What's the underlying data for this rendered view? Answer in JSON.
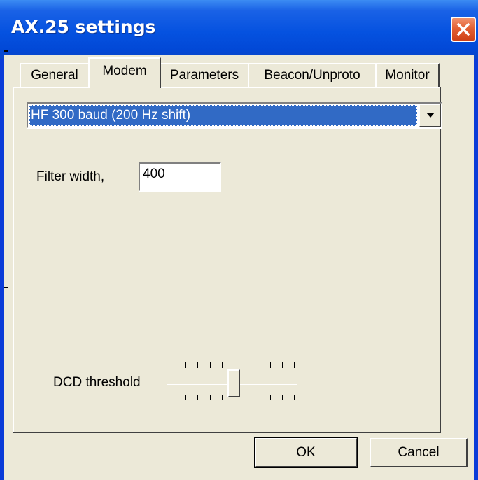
{
  "window": {
    "title": "AX.25 settings",
    "close_icon": "close-icon"
  },
  "tabs": [
    {
      "label": "General",
      "active": false
    },
    {
      "label": "Modem",
      "active": true
    },
    {
      "label": "Parameters",
      "active": false
    },
    {
      "label": "Beacon/Unproto",
      "active": false
    },
    {
      "label": "Monitor",
      "active": false
    }
  ],
  "modem": {
    "mode_select": {
      "selected": "HF 300 baud  (200 Hz shift)"
    },
    "filter_width": {
      "label": "Filter width,",
      "value": "400"
    },
    "dcd_threshold": {
      "label": "DCD threshold",
      "level_fraction": 0.5,
      "tick_count": 11
    }
  },
  "buttons": {
    "ok": "OK",
    "cancel": "Cancel"
  },
  "colors": {
    "title_bar": "#0552e0",
    "close_button": "#e36033",
    "dialog_face": "#ece9d8",
    "selection": "#316ac5"
  }
}
